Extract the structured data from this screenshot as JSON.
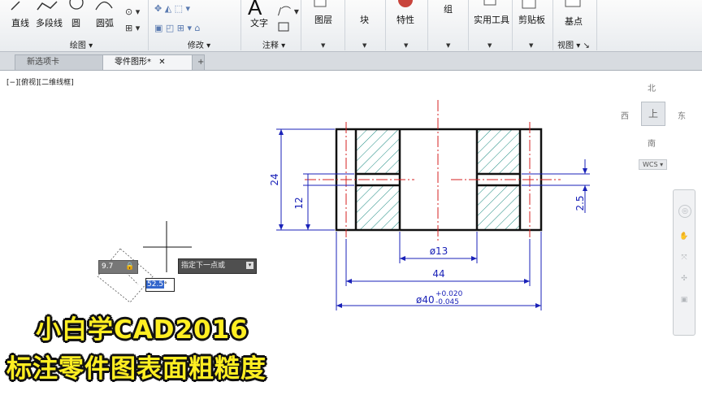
{
  "ribbon": {
    "draw_buttons": [
      "直线",
      "多段线",
      "圆",
      "圆弧"
    ],
    "text_button": "文字",
    "big_buttons": [
      "图层",
      "块",
      "特性",
      "组",
      "实用工具",
      "剪贴板",
      "基点"
    ],
    "groups": [
      "绘图",
      "修改",
      "注释",
      "视图"
    ]
  },
  "tabs": [
    "新选项卡",
    "零件图形*"
  ],
  "viewport_label": "[−][俯视][二维线框]",
  "viewcube": {
    "north": "北",
    "south": "南",
    "east": "东",
    "west": "西",
    "top": "上",
    "wcs": "WCS"
  },
  "drawing": {
    "dims": {
      "d24": "24",
      "d12": "12",
      "d25": "2.5",
      "d13": "ø13",
      "d44": "44",
      "d40": "ø40",
      "tol_upper": "+0.020",
      "tol_lower": "-0.045"
    },
    "colors": {
      "outline": "#111111",
      "centerline": "#d42020",
      "dimension": "#1a22b8",
      "hatch": "#1a8a80"
    }
  },
  "dynamic_input": {
    "length": "9.7",
    "angle": "52.5",
    "prompt": "指定下一点或"
  },
  "caption": {
    "line1": "小白学CAD2016",
    "line2": "标注零件图表面粗糙度"
  }
}
